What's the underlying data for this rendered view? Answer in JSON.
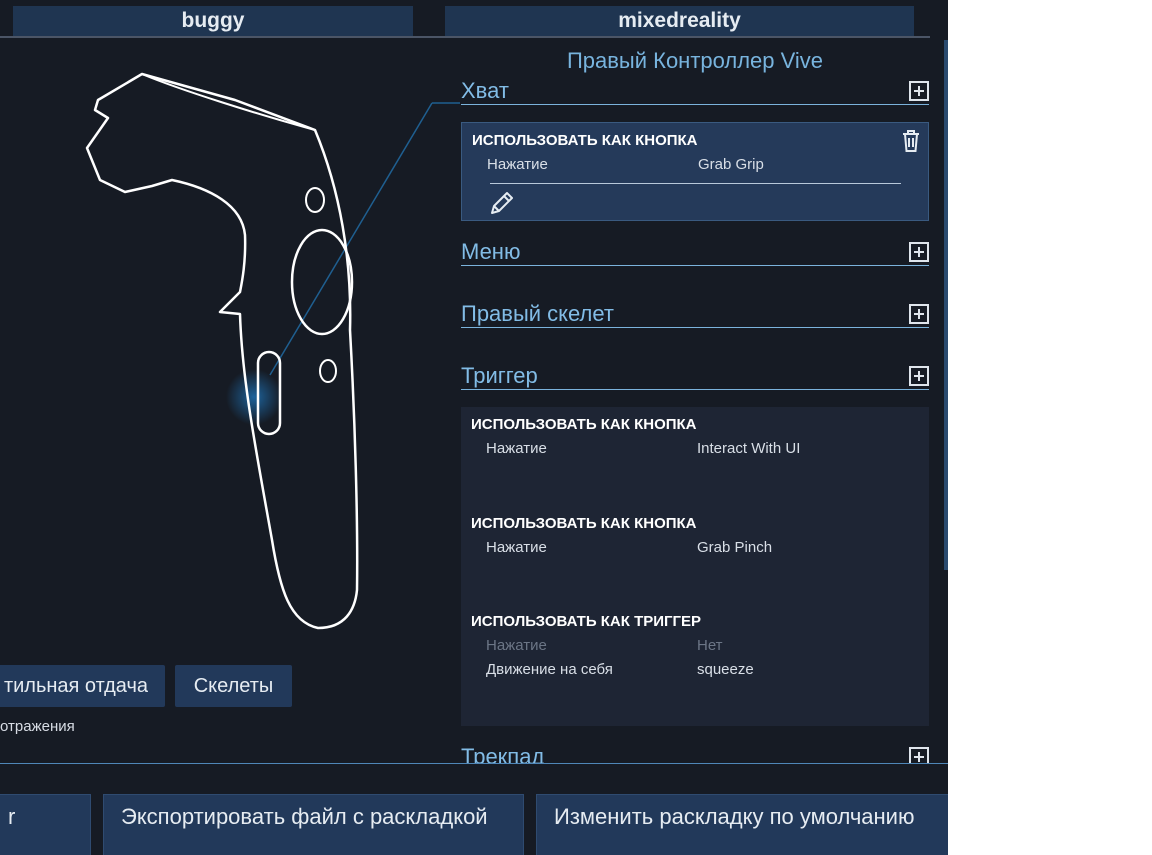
{
  "tabs": [
    "buggy",
    "mixedreality"
  ],
  "left": {
    "buttons": [
      "тильная отдача",
      "Скелеты"
    ],
    "caption": "отражения"
  },
  "right": {
    "title": "Правый Контроллер Vive",
    "sections": [
      {
        "label": "Хват"
      },
      {
        "label": "Меню"
      },
      {
        "label": "Правый скелет"
      },
      {
        "label": "Триггер"
      },
      {
        "label": "Трекпад"
      }
    ],
    "grip_binding": {
      "mode": "ИСПОЛЬЗОВАТЬ КАК КНОПКА",
      "input": "Нажатие",
      "action": "Grab Grip"
    },
    "trigger_bindings": [
      {
        "mode": "ИСПОЛЬЗОВАТЬ КАК КНОПКА",
        "rows": [
          {
            "input": "Нажатие",
            "action": "Interact With UI"
          }
        ]
      },
      {
        "mode": "ИСПОЛЬЗОВАТЬ КАК КНОПКА",
        "rows": [
          {
            "input": "Нажатие",
            "action": "Grab Pinch"
          }
        ]
      },
      {
        "mode": "ИСПОЛЬЗОВАТЬ КАК ТРИГГЕР",
        "rows": [
          {
            "input": "Нажатие",
            "action": "Нет"
          },
          {
            "input": "Движение на себя",
            "action": "squeeze"
          }
        ]
      }
    ]
  },
  "footer": {
    "buttons": [
      "r",
      "Экспортировать файл с раскладкой",
      "Изменить раскладку по умолчанию"
    ]
  },
  "colors": {
    "background": "#161b24",
    "accent": "#82bce6",
    "panel": "#253a5a",
    "button": "#22395a"
  }
}
